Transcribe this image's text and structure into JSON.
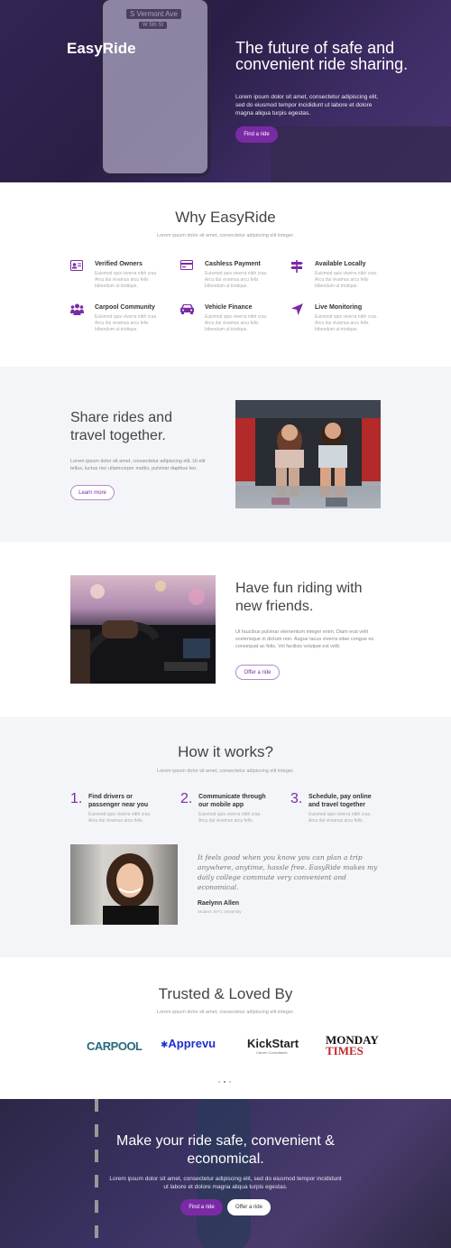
{
  "hero": {
    "brand": "EasyRide",
    "title": "The future of safe and convenient ride sharing.",
    "description": "Lorem ipsum dolor sit amet, consectetur adipiscing elit, sed do eiusmod tempor incididunt ut labore et dolore magna aliqua turpis egestas.",
    "cta": "Find a ride",
    "map_street_1": "S Vermont Ave",
    "map_street_2": "W 5th St"
  },
  "why": {
    "title": "Why EasyRide",
    "subtitle": "Lorem ipsum dolor sit amet, consectetur adipiscing elit integer.",
    "features": [
      {
        "icon": "id-card-icon",
        "title": "Verified Owners",
        "desc": "Euismod quis viverra nibh cras. Arcu dui vivamus arcu felis bibendum ut tristique."
      },
      {
        "icon": "credit-card-icon",
        "title": "Cashless Payment",
        "desc": "Euismod quis viverra nibh cras. Arcu dui vivamus arcu felis bibendum ut tristique."
      },
      {
        "icon": "signpost-icon",
        "title": "Available Locally",
        "desc": "Euismod quis viverra nibh cras. Arcu dui vivamus arcu felis bibendum ut tristique."
      },
      {
        "icon": "people-icon",
        "title": "Carpool Community",
        "desc": "Euismod quis viverra nibh cras. Arcu dui vivamus arcu felis bibendum ut tristique."
      },
      {
        "icon": "car-icon",
        "title": "Vehicle Finance",
        "desc": "Euismod quis viverra nibh cras. Arcu dui vivamus arcu felis bibendum ut tristique."
      },
      {
        "icon": "location-arrow-icon",
        "title": "Live Monitoring",
        "desc": "Euismod quis viverra nibh cras. Arcu dui vivamus arcu felis bibendum ut tristique."
      }
    ]
  },
  "share": {
    "title": "Share rides and travel together.",
    "text": "Lorem ipsum dolor sit amet, consectetur adipiscing elit. Ut elit tellus, luctus nec ullamcorper mattis, pulvinar dapibus leo.",
    "cta": "Learn more"
  },
  "fun": {
    "title": "Have fun riding with new friends.",
    "text": "Ut faucibus pulvinar elementum integer enim. Diam erat velit scelerisque in dictum non. Augue lacus viverra vitae congue eu consequat ac felis. Vel facilisis volutpat est velit.",
    "cta": "Offer a ride"
  },
  "how": {
    "title": "How it works?",
    "subtitle": "Lorem ipsum dolor sit amet, consectetur adipiscing elit integer.",
    "steps": [
      {
        "num": "1.",
        "title": "Find drivers or passenger near you",
        "desc": "Euismod quis viverra nibh cras. Arcu dui vivamus arcu felis."
      },
      {
        "num": "2.",
        "title": "Communicate through our mobile app",
        "desc": "Euismod quis viverra nibh cras. Arcu dui vivamus arcu felis."
      },
      {
        "num": "3.",
        "title": "Schedule, pay online and travel together",
        "desc": "Euismod quis viverra nibh cras. Arcu dui vivamus arcu felis."
      }
    ],
    "quote": "It feels good when you know you can plan a trip anywhere, anytime, hassle free. EasyRide makes my daily college commute very convenient and economical.",
    "author": "Raelynn Allen",
    "author_role": "Student, NYC University"
  },
  "trusted": {
    "title": "Trusted & Loved By",
    "subtitle": "Lorem ipsum dolor sit amet, consectetur adipiscing elit integer.",
    "logos": {
      "carpool": "CARPOOL",
      "apprevu": "Apprevu",
      "kickstart": "KickStart",
      "kickstart_sub": "Career Consultants",
      "monday": "MONDAY",
      "times": "TIMES"
    }
  },
  "footer": {
    "title": "Make your ride safe, convenient & economical.",
    "text": "Lorem ipsum dolor sit amet, consectetur adipiscing elit, sed do eiusmod tempor incididunt ut labore et dolore magna aliqua turpis egestas.",
    "cta_primary": "Find a ride",
    "cta_secondary": "Offer a ride"
  },
  "colors": {
    "accent": "#7b2aa6",
    "section_gray": "#f4f5f8"
  }
}
